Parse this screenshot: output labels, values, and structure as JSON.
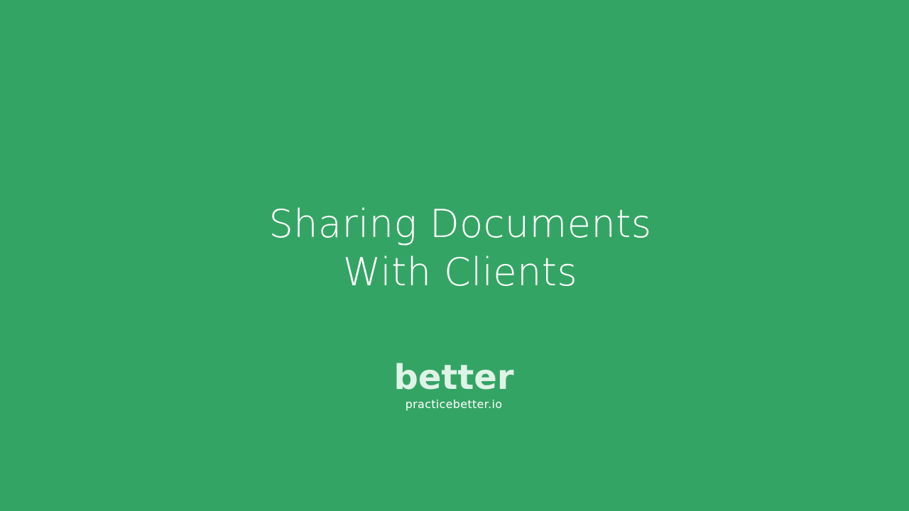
{
  "slide": {
    "background_color": "#34a464",
    "title_lines": [
      "Sharing Documents",
      "With Clients"
    ]
  },
  "brand": {
    "logo_text": "better",
    "url": "practicebetter.io",
    "logo_color": "#dff3e7"
  }
}
